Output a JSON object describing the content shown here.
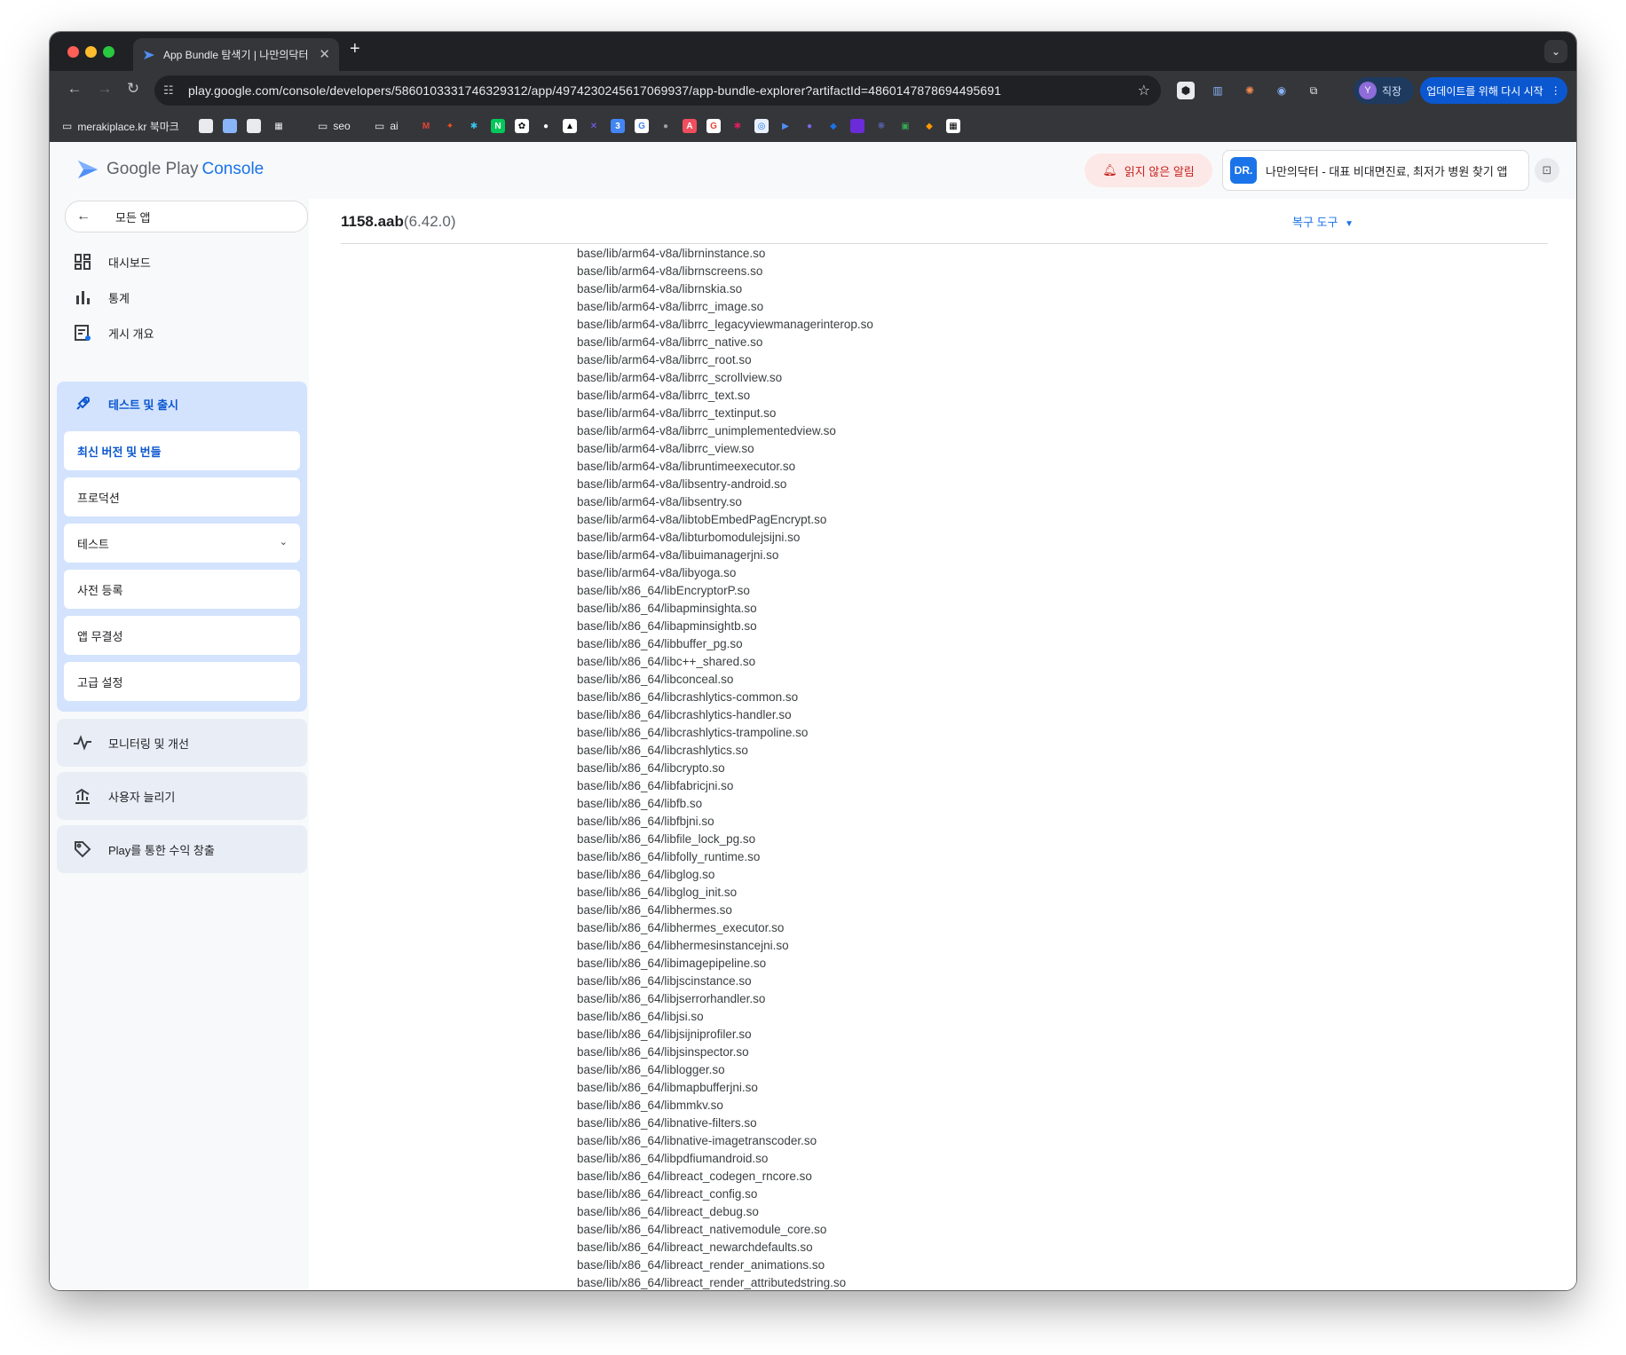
{
  "browser": {
    "tab_title": "App Bundle 탐색기 | 나만의닥터",
    "url": "play.google.com/console/developers/5860103331746329312/app/4974230245617069937/app-bundle-explorer?artifactId=4860147878694495691",
    "profile_initial": "Y",
    "profile_label": "직장",
    "update_label": "업데이트를 위해 다시 시작",
    "bookmarks": {
      "first_label": "merakiplace.kr 북마크",
      "folder_seo": "seo",
      "folder_ai": "ai"
    }
  },
  "header": {
    "brand_google_play": "Google Play",
    "brand_console": "Console",
    "alerts_label": "읽지 않은 알림",
    "app_name": "나만의닥터 - 대표 비대면진료, 최저가 병원 찾기 앱",
    "app_logo_text": "DR."
  },
  "sidebar": {
    "back_label": "모든 앱",
    "items": [
      {
        "label": "대시보드",
        "icon": "dashboard-icon"
      },
      {
        "label": "통계",
        "icon": "bar-chart-icon"
      },
      {
        "label": "게시 개요",
        "icon": "publishing-overview-icon"
      }
    ],
    "active_group": {
      "label": "테스트 및 출시",
      "icon": "rocket-icon",
      "subitems": [
        "최신 버전 및 번들",
        "프로덕션",
        "테스트",
        "사전 등록",
        "앱 무결성",
        "고급 설정"
      ]
    },
    "groups": [
      {
        "label": "모니터링 및 개선",
        "icon": "pulse-icon"
      },
      {
        "label": "사용자 늘리기",
        "icon": "growth-icon"
      },
      {
        "label": "Play를 통한 수익 창출",
        "icon": "tag-icon"
      }
    ]
  },
  "main": {
    "title_file": "1158.aab",
    "title_version": "(6.42.0)",
    "tools_label": "복구 도구",
    "files": [
      "base/lib/arm64-v8a/librninstance.so",
      "base/lib/arm64-v8a/librnscreens.so",
      "base/lib/arm64-v8a/librnskia.so",
      "base/lib/arm64-v8a/librrc_image.so",
      "base/lib/arm64-v8a/librrc_legacyviewmanagerinterop.so",
      "base/lib/arm64-v8a/librrc_native.so",
      "base/lib/arm64-v8a/librrc_root.so",
      "base/lib/arm64-v8a/librrc_scrollview.so",
      "base/lib/arm64-v8a/librrc_text.so",
      "base/lib/arm64-v8a/librrc_textinput.so",
      "base/lib/arm64-v8a/librrc_unimplementedview.so",
      "base/lib/arm64-v8a/librrc_view.so",
      "base/lib/arm64-v8a/libruntimeexecutor.so",
      "base/lib/arm64-v8a/libsentry-android.so",
      "base/lib/arm64-v8a/libsentry.so",
      "base/lib/arm64-v8a/libtobEmbedPagEncrypt.so",
      "base/lib/arm64-v8a/libturbomodulejsijni.so",
      "base/lib/arm64-v8a/libuimanagerjni.so",
      "base/lib/arm64-v8a/libyoga.so",
      "base/lib/x86_64/libEncryptorP.so",
      "base/lib/x86_64/libapminsighta.so",
      "base/lib/x86_64/libapminsightb.so",
      "base/lib/x86_64/libbuffer_pg.so",
      "base/lib/x86_64/libc++_shared.so",
      "base/lib/x86_64/libconceal.so",
      "base/lib/x86_64/libcrashlytics-common.so",
      "base/lib/x86_64/libcrashlytics-handler.so",
      "base/lib/x86_64/libcrashlytics-trampoline.so",
      "base/lib/x86_64/libcrashlytics.so",
      "base/lib/x86_64/libcrypto.so",
      "base/lib/x86_64/libfabricjni.so",
      "base/lib/x86_64/libfb.so",
      "base/lib/x86_64/libfbjni.so",
      "base/lib/x86_64/libfile_lock_pg.so",
      "base/lib/x86_64/libfolly_runtime.so",
      "base/lib/x86_64/libglog.so",
      "base/lib/x86_64/libglog_init.so",
      "base/lib/x86_64/libhermes.so",
      "base/lib/x86_64/libhermes_executor.so",
      "base/lib/x86_64/libhermesinstancejni.so",
      "base/lib/x86_64/libimagepipeline.so",
      "base/lib/x86_64/libjscinstance.so",
      "base/lib/x86_64/libjserrorhandler.so",
      "base/lib/x86_64/libjsi.so",
      "base/lib/x86_64/libjsijniprofiler.so",
      "base/lib/x86_64/libjsinspector.so",
      "base/lib/x86_64/liblogger.so",
      "base/lib/x86_64/libmapbufferjni.so",
      "base/lib/x86_64/libmmkv.so",
      "base/lib/x86_64/libnative-filters.so",
      "base/lib/x86_64/libnative-imagetranscoder.so",
      "base/lib/x86_64/libpdfiumandroid.so",
      "base/lib/x86_64/libreact_codegen_rncore.so",
      "base/lib/x86_64/libreact_config.so",
      "base/lib/x86_64/libreact_debug.so",
      "base/lib/x86_64/libreact_nativemodule_core.so",
      "base/lib/x86_64/libreact_newarchdefaults.so",
      "base/lib/x86_64/libreact_render_animations.so",
      "base/lib/x86_64/libreact_render_attributedstring.so"
    ]
  }
}
